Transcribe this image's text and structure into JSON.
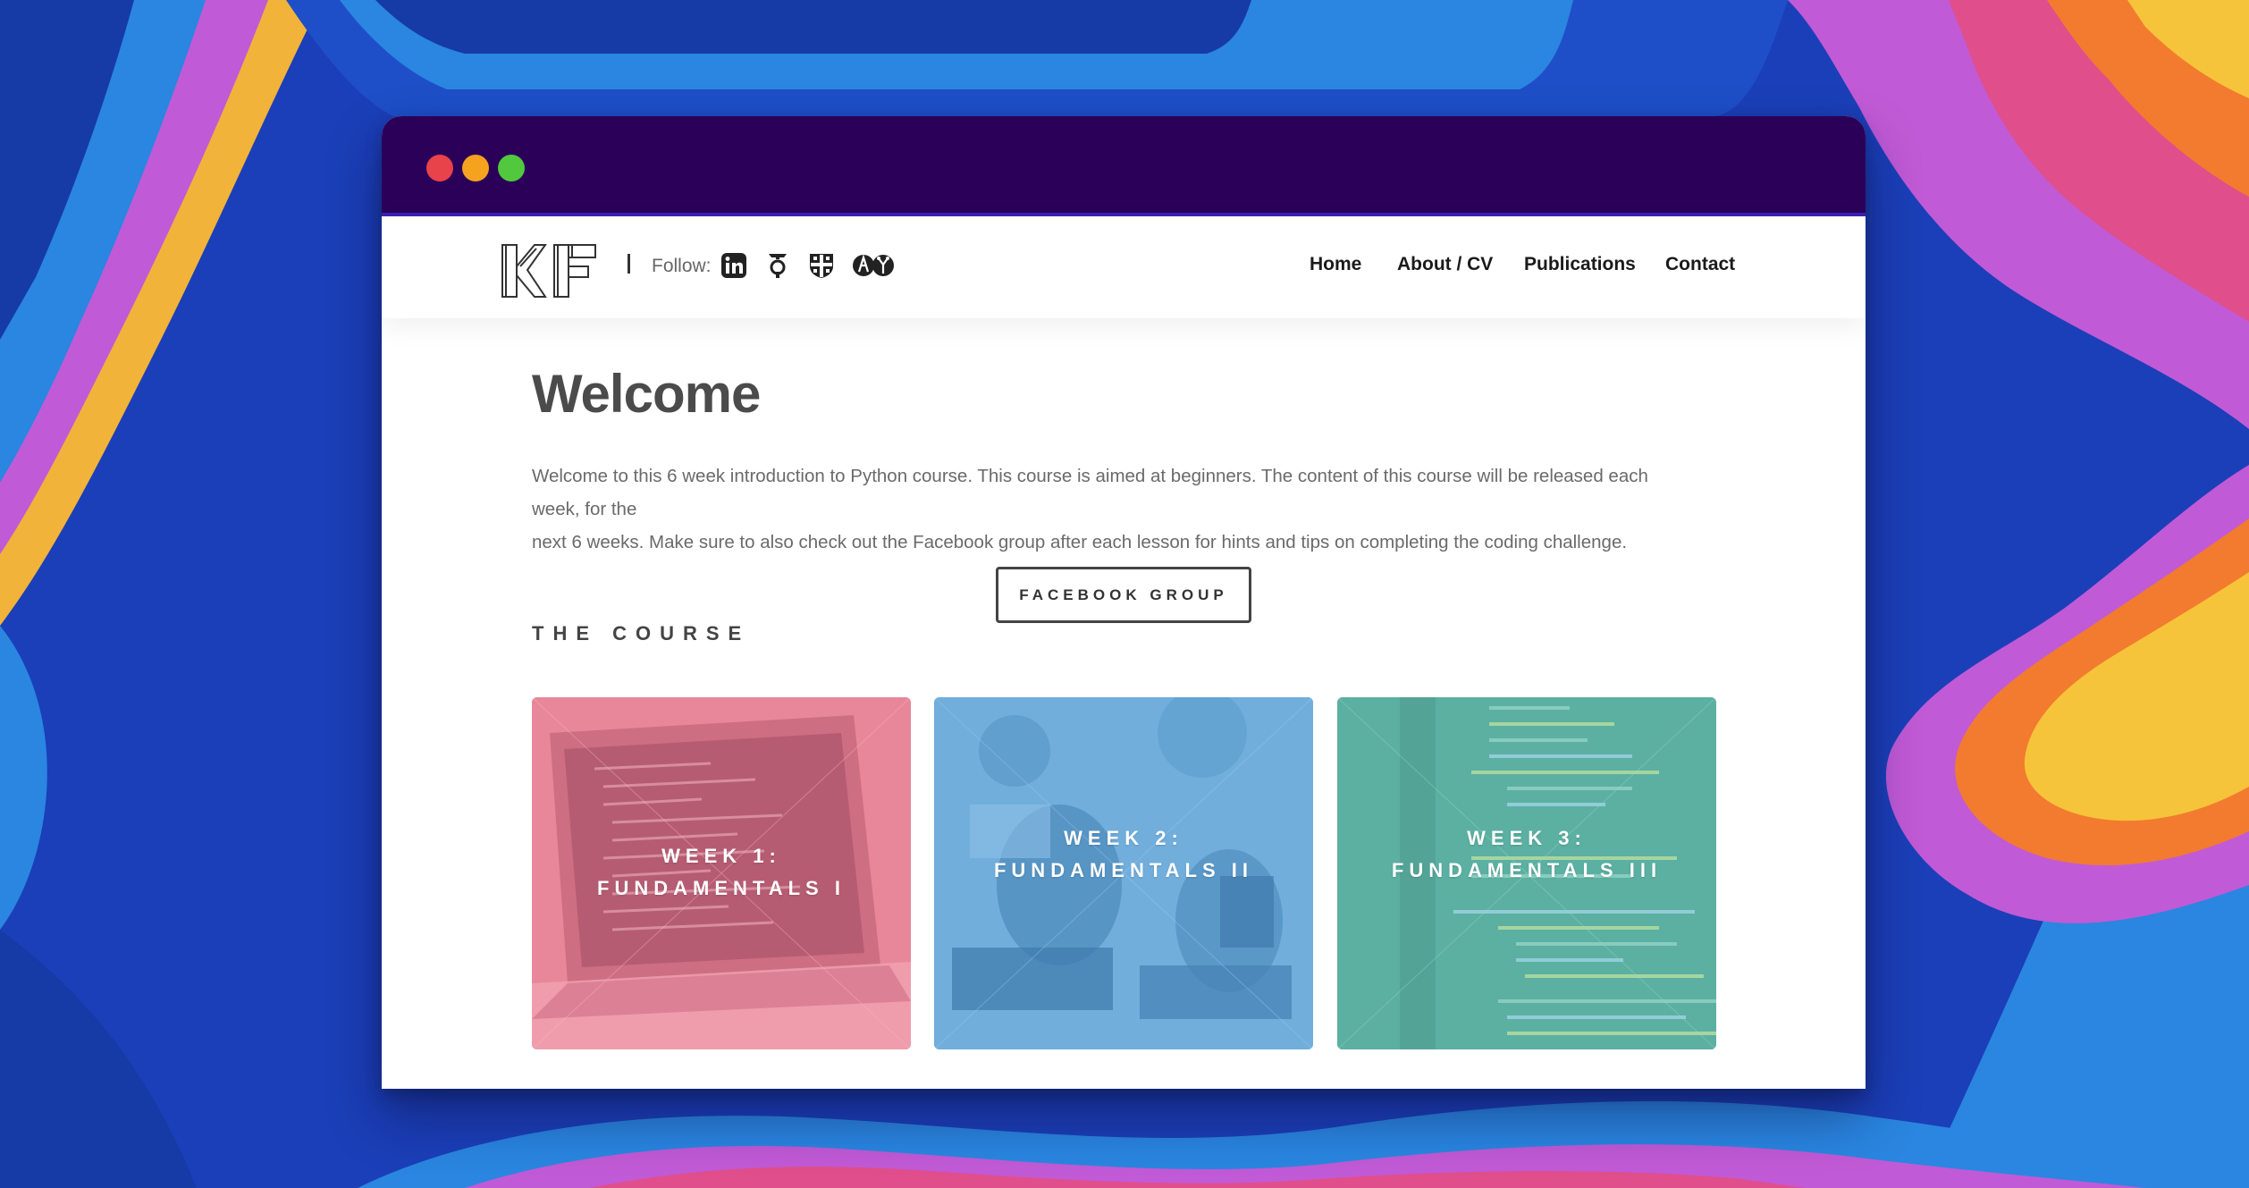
{
  "colors": {
    "titlebar": "#2b0058",
    "card_week1": "#e8879a",
    "card_week2": "#71aedc",
    "card_week3": "#5bb0a2"
  },
  "window_controls": [
    "close",
    "minimize",
    "maximize"
  ],
  "header": {
    "logo_icon": "kf-monogram-logo",
    "follow_label": "Follow:",
    "social_icons": [
      "linkedin-icon",
      "google-scholar-icon",
      "university-crest-icon",
      "researchgate-icon"
    ],
    "nav": [
      {
        "label": "Home"
      },
      {
        "label": "About / CV"
      },
      {
        "label": "Publications"
      },
      {
        "label": "Contact"
      }
    ]
  },
  "main": {
    "title": "Welcome",
    "intro_line1": "Welcome to this 6 week introduction to Python course. This course is aimed at beginners. The content of this course will be released each week, for the",
    "intro_line2": "next 6 weeks. Make sure to also check out the Facebook group after each lesson for hints and tips on completing the coding challenge.",
    "facebook_button": "FACEBOOK GROUP",
    "section_title": "THE COURSE",
    "cards": [
      {
        "line1": "WEEK 1:",
        "line2": "FUNDAMENTALS I",
        "image": "laptop-photo"
      },
      {
        "line1": "WEEK 2:",
        "line2": "FUNDAMENTALS II",
        "image": "classroom-photo"
      },
      {
        "line1": "WEEK 3:",
        "line2": "FUNDAMENTALS III",
        "image": "code-screen-photo"
      }
    ]
  }
}
